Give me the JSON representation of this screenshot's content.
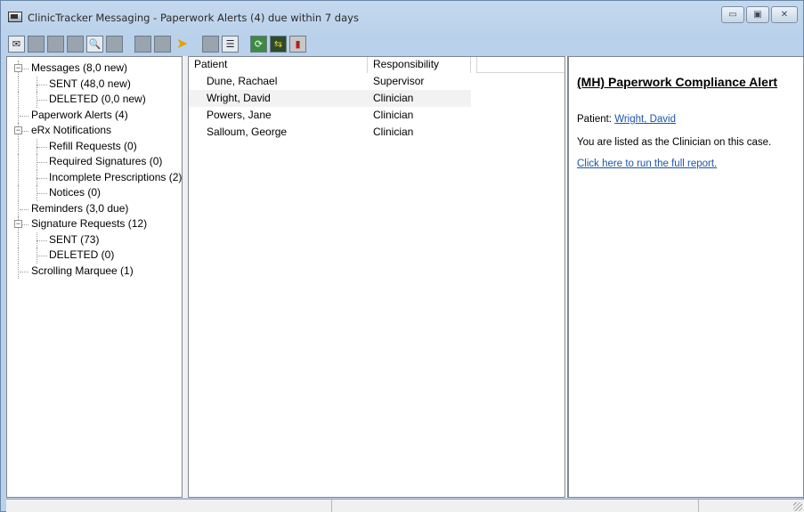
{
  "window": {
    "title": "ClinicTracker Messaging - Paperwork Alerts (4) due within 7 days",
    "minimize_glyph": "▭",
    "maximize_glyph": "▣",
    "close_glyph": "✕"
  },
  "toolbar": {
    "icons": [
      "new-message-icon",
      "reply-icon",
      "reply-all-icon",
      "preview-icon",
      "print-icon",
      "delete-icon",
      "forward-icon",
      "tag-icon",
      "flag-icon",
      "notes-icon",
      "refresh-icon",
      "sync-icon",
      "marquee-icon"
    ]
  },
  "tree": {
    "nodes": [
      {
        "label": "Messages (8,0 new)",
        "level": 0,
        "expander": "−"
      },
      {
        "label": "SENT  (48,0 new)",
        "level": 1
      },
      {
        "label": "DELETED  (0,0 new)",
        "level": 1
      },
      {
        "label": "Paperwork Alerts (4)",
        "level": 0
      },
      {
        "label": "eRx Notifications",
        "level": 0,
        "expander": "−"
      },
      {
        "label": "Refill Requests (0)",
        "level": 1
      },
      {
        "label": "Required Signatures (0)",
        "level": 1
      },
      {
        "label": "Incomplete Prescriptions (2)",
        "level": 1
      },
      {
        "label": "Notices (0)",
        "level": 1
      },
      {
        "label": "Reminders (3,0 due)",
        "level": 0
      },
      {
        "label": "Signature Requests (12)",
        "level": 0,
        "expander": "−"
      },
      {
        "label": "SENT  (73)",
        "level": 1
      },
      {
        "label": "DELETED  (0)",
        "level": 1
      },
      {
        "label": "Scrolling Marquee (1)",
        "level": 0
      }
    ]
  },
  "list": {
    "columns": [
      "Patient",
      "Responsibility"
    ],
    "rows": [
      {
        "patient": "Dune, Rachael",
        "responsibility": "Supervisor"
      },
      {
        "patient": "Wright, David",
        "responsibility": "Clinician",
        "selected": true
      },
      {
        "patient": "Powers, Jane",
        "responsibility": "Clinician"
      },
      {
        "patient": "Salloum, George",
        "responsibility": "Clinician"
      }
    ]
  },
  "detail": {
    "title": "(MH) Paperwork Compliance Alert",
    "patient_label": "Patient: ",
    "patient_name": "Wright, David",
    "message": "You are listed as the Clinician on this case.",
    "report_link": "Click here to run the full report."
  },
  "colors": {
    "link": "#1a56a8",
    "selected_row": "#f2f2f2",
    "titlebar": "#b9d1ea"
  }
}
